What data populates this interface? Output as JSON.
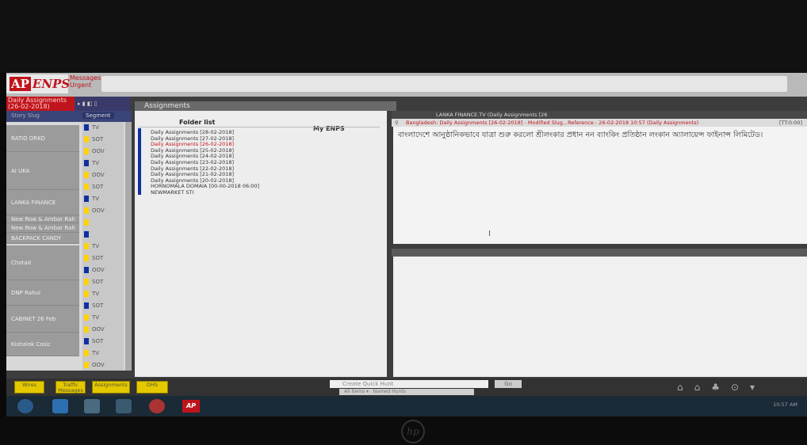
{
  "app": {
    "logo_text": "ENPS",
    "logo_badge": "AP",
    "messages_label": "Messages:",
    "urgent_label": "Urgent"
  },
  "left_pane": {
    "title_line1": "Daily Assignments",
    "title_line2": "(26-02-2018)",
    "header_col1": "Story Slug",
    "header_col2": "Segment",
    "rows": [
      "RATIO ORKO",
      "AI UKA",
      "LANKA FINANCE",
      "New Row & Ambar Rah",
      "New Row & Ambar Rah",
      "BACKPACK CANDY",
      "Chotad",
      "DNP Rahul",
      "CABINET 26 Feb",
      "Kishalok Cosic"
    ],
    "tags": [
      "TV",
      "SOT",
      "OOV",
      "TV",
      "OOV",
      "SOT",
      "TV",
      "OOV",
      "",
      "",
      "TV",
      "SOT",
      "OOV",
      "SOT",
      "TV",
      "SOT",
      "TV",
      "OOV",
      "SOT",
      "TV",
      "OOV"
    ]
  },
  "assignments": {
    "title": "Assignments",
    "folder_list_label": "Folder list",
    "my_enps_label": "My ENPS",
    "items": [
      {
        "text": "Daily Assignments [28-02-2018]",
        "red": false
      },
      {
        "text": "Daily Assignments [27-02-2018]",
        "red": false
      },
      {
        "text": "Daily Assignments [26-02-2018]",
        "red": true
      },
      {
        "text": "Daily Assignments [25-02-2018]",
        "red": false
      },
      {
        "text": "Daily Assignments [24-02-2018]",
        "red": false
      },
      {
        "text": "Daily Assignments [23-02-2018]",
        "red": false
      },
      {
        "text": "Daily Assignments [22-02-2018]",
        "red": false
      },
      {
        "text": "Daily Assignments [21-02-2018]",
        "red": false
      },
      {
        "text": "Daily Assignments [20-02-2018]",
        "red": false
      },
      {
        "text": "HORNOMALA DOMAIA [00-00-2018 06:00]",
        "red": false
      },
      {
        "text": "NEWMARKET STI",
        "red": false
      }
    ]
  },
  "story": {
    "title": "LANKA FINANCE.TV (Daily Assignments [26",
    "path": "Bangladesh: Daily Assignments [26-02-2018] - Modified Slug...Reference - 26-02-2018 10:57 (Daily Assignments)",
    "path_right": "[TT:0:00]",
    "body": "বাংলাদেশে আনুষ্ঠানিকভাবে যাত্রা শুরু করলো শ্রীলংকার প্রধান নন ব্যাংকিং প্রতিষ্ঠান লংকান অ্যালায়েন্স ফাইনান্স লিমিটেড।"
  },
  "folder_bar": {
    "buttons": [
      "Wires",
      "Traffic\nMessages",
      "Assignments",
      "DHS"
    ],
    "search_placeholder": "Create Quick Hunt",
    "search_scope": "All Items",
    "search_type": "Named Hunts",
    "go_label": "Go"
  },
  "taskbar": {
    "clock": "10:57 AM"
  }
}
